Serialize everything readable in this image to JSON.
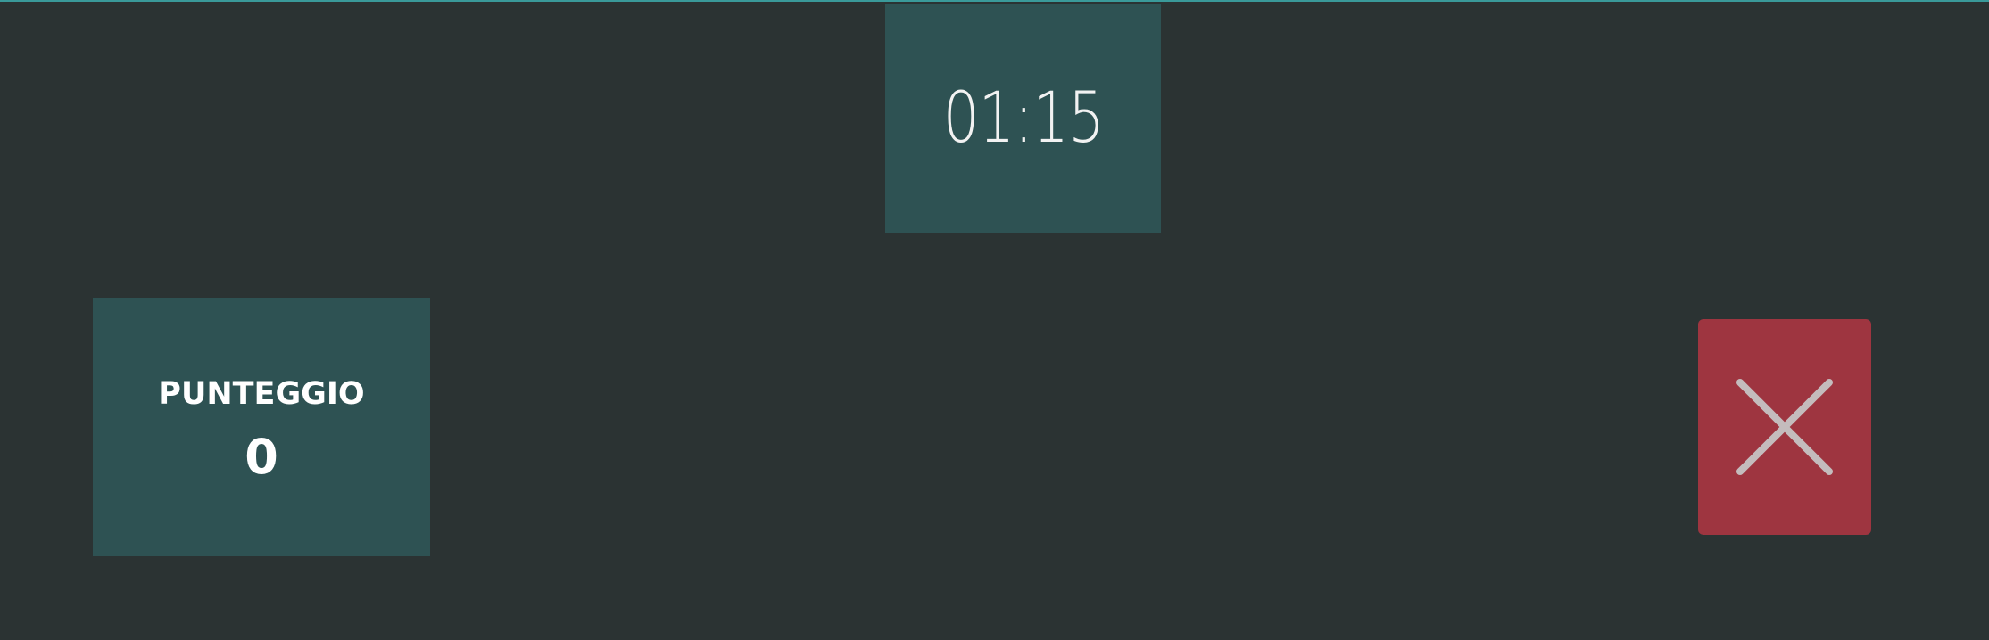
{
  "timer": {
    "value": "01:15"
  },
  "score": {
    "label": "PUNTEGGIO",
    "value": "0"
  },
  "close_button": {
    "icon": "close-icon"
  },
  "colors": {
    "background": "#2b3333",
    "panel": "#2e5253",
    "close_button": "#9e3540",
    "accent_line": "#3a9a9a"
  }
}
